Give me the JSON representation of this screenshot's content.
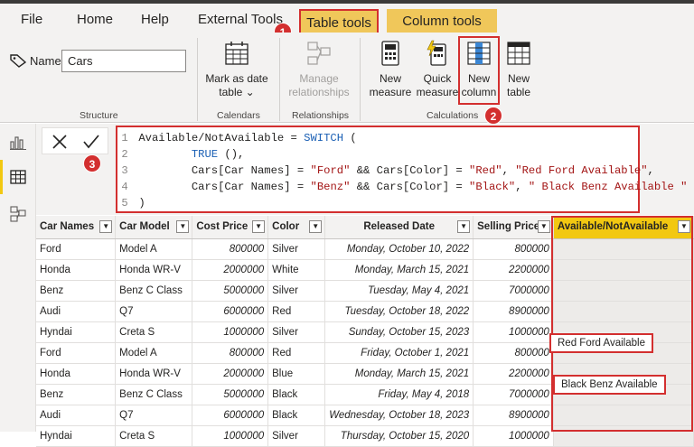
{
  "menu": {
    "file": "File",
    "home": "Home",
    "help": "Help",
    "external_tools": "External Tools",
    "table_tools": "Table tools",
    "column_tools": "Column tools"
  },
  "badges": {
    "one": "1",
    "two": "2",
    "three": "3"
  },
  "ribbon": {
    "name_label": "Name",
    "name_value": "Cars",
    "structure_label": "Structure",
    "mark_as_date_line1": "Mark as date",
    "mark_as_date_line2": "table",
    "calendars_label": "Calendars",
    "manage_line1": "Manage",
    "manage_line2": "relationships",
    "relationships_label": "Relationships",
    "new_measure_line1": "New",
    "new_measure_line2": "measure",
    "quick_measure_line1": "Quick",
    "quick_measure_line2": "measure",
    "new_column_line1": "New",
    "new_column_line2": "column",
    "new_table_line1": "New",
    "new_table_line2": "table",
    "calculations_label": "Calculations"
  },
  "formula": {
    "lines": [
      {
        "num": "1",
        "text": "Available/NotAvailable = ",
        "kw": "SWITCH",
        "rest": " ("
      },
      {
        "num": "2",
        "indent": "        ",
        "kw": "TRUE",
        "rest": " (),"
      },
      {
        "num": "3",
        "indent": "        ",
        "a": "Cars[Car Names] = ",
        "s1": "\"Ford\"",
        "b": " && Cars[Color] = ",
        "s2": "\"Red\"",
        "c": ", ",
        "s3": "\"Red Ford Available\"",
        "d": ","
      },
      {
        "num": "4",
        "indent": "        ",
        "a": "Cars[Car Names] = ",
        "s1": "\"Benz\"",
        "b": " && Cars[Color] = ",
        "s2": "\"Black\"",
        "c": ", ",
        "s3": "\" Black Benz Available \"",
        "d": ""
      },
      {
        "num": "5",
        "text": ")"
      }
    ]
  },
  "table": {
    "columns": [
      "Car Names",
      "Car Model",
      "Cost Price",
      "Color",
      "Released Date",
      "Selling Price",
      "Available/NotAvailable"
    ],
    "rows": [
      [
        "Ford",
        "Model A",
        "800000",
        "Silver",
        "Monday, October 10, 2022",
        "800000",
        ""
      ],
      [
        "Honda",
        "Honda WR-V",
        "2000000",
        "White",
        "Monday, March 15, 2021",
        "2200000",
        ""
      ],
      [
        "Benz",
        "Benz C Class",
        "5000000",
        "Silver",
        "Tuesday, May 4, 2021",
        "7000000",
        ""
      ],
      [
        "Audi",
        "Q7",
        "6000000",
        "Red",
        "Tuesday, October 18, 2022",
        "8900000",
        ""
      ],
      [
        "Hyndai",
        "Creta S",
        "1000000",
        "Silver",
        "Sunday, October 15, 2023",
        "1000000",
        ""
      ],
      [
        "Ford",
        "Model A",
        "800000",
        "Red",
        "Friday, October 1, 2021",
        "800000",
        "Red Ford Available"
      ],
      [
        "Honda",
        "Honda WR-V",
        "2000000",
        "Blue",
        "Monday, March 15, 2021",
        "2200000",
        ""
      ],
      [
        "Benz",
        "Benz C Class",
        "5000000",
        "Black",
        "Friday, May 4, 2018",
        "7000000",
        "Black Benz Available"
      ],
      [
        "Audi",
        "Q7",
        "6000000",
        "Black",
        "Wednesday, October 18, 2023",
        "8900000",
        ""
      ],
      [
        "Hyndai",
        "Creta S",
        "1000000",
        "Silver",
        "Thursday, October 15, 2020",
        "1000000",
        ""
      ]
    ]
  },
  "colors": {
    "accent": "#f2c811",
    "highlight": "#d32f2f"
  }
}
